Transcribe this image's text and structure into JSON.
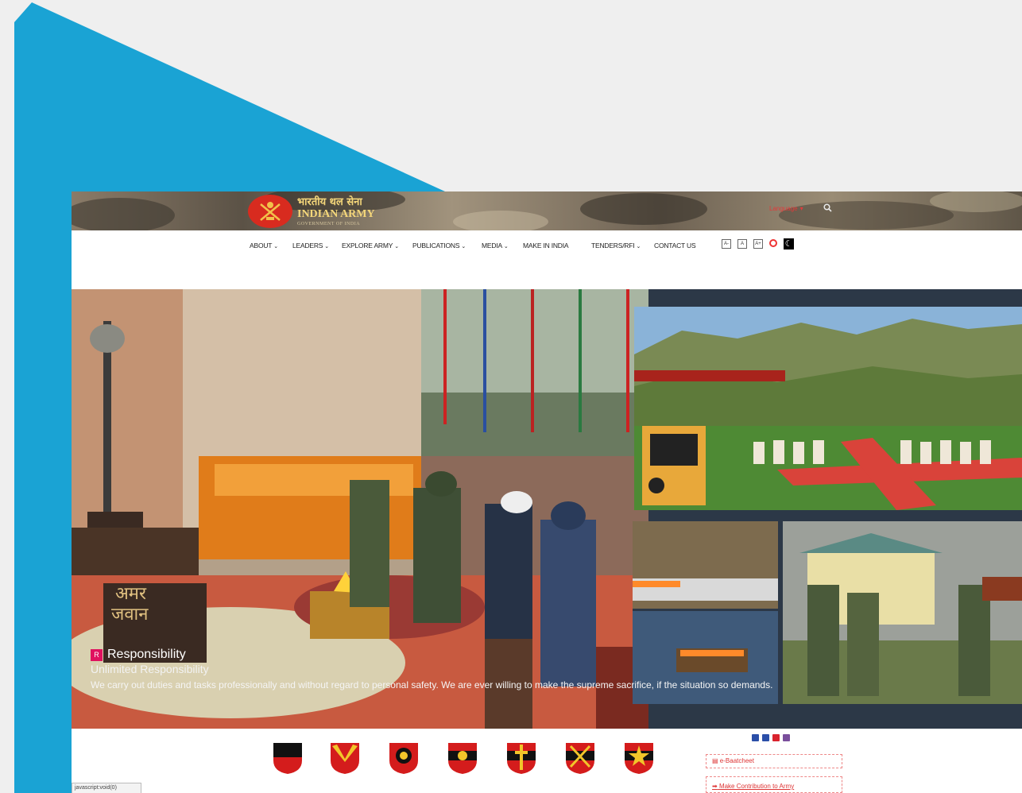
{
  "header": {
    "logo_hindi": "भारतीय थल सेना",
    "logo_english": "INDIAN ARMY",
    "logo_gov": "GOVERNMENT OF INDIA",
    "language_label": "Language",
    "search_icon": "search-icon"
  },
  "nav": {
    "items": [
      {
        "label": "ABOUT",
        "has_dropdown": true
      },
      {
        "label": "LEADERS",
        "has_dropdown": true
      },
      {
        "label": "EXPLORE ARMY",
        "has_dropdown": true
      },
      {
        "label": "PUBLICATIONS",
        "has_dropdown": true
      },
      {
        "label": "MEDIA",
        "has_dropdown": true
      },
      {
        "label": "MAKE IN INDIA",
        "has_dropdown": false
      },
      {
        "label": "TENDERS/RFI",
        "has_dropdown": true
      },
      {
        "label": "CONTACT US",
        "has_dropdown": false
      }
    ],
    "caret": "⌄",
    "a11y": {
      "font_decrease": "A-",
      "font_reset": "A",
      "font_increase": "A+",
      "contrast_icon": "contrast-icon",
      "dark_mode_icon": "moon-icon"
    }
  },
  "hero": {
    "badge_letter": "R",
    "title": "Responsibility",
    "subtitle": "Unlimited Responsibility",
    "description": "We carry out duties and tasks professionally and without regard to personal safety. We are ever willing to make the supreme sacrifice, if the situation so demands.",
    "image_left": "amar-jawan-ceremony",
    "image_top_right": "war-memorial-cemetery",
    "image_bottom_right": "soldiers-saluting"
  },
  "formation_badges": [
    "badge-1",
    "badge-2",
    "badge-3",
    "badge-4",
    "badge-5",
    "badge-6",
    "badge-7"
  ],
  "sidebar_links": {
    "social_icons": [
      "facebook-icon",
      "twitter-icon",
      "youtube-icon",
      "instagram-icon"
    ],
    "ebaatcheet": "e-Baatcheet",
    "contribution": "Make Contribution to Army"
  },
  "status_bar": {
    "text": "javascript:void(0)"
  },
  "colors": {
    "accent_blue": "#1aa3d4",
    "brand_red": "#d82b1f",
    "hero_bg": "#2c3847",
    "caption_badge": "#e0115f"
  }
}
